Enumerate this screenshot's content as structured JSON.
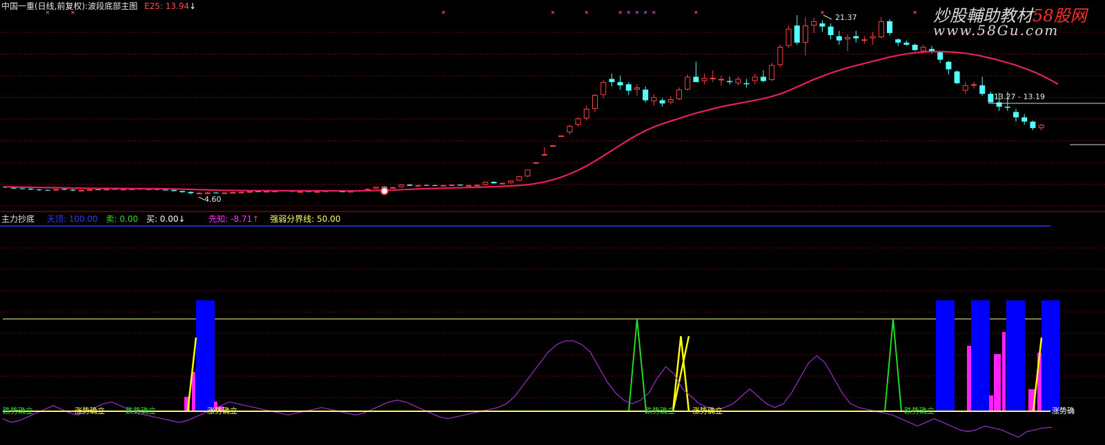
{
  "header": {
    "main_title": "中国一重(日线,前复权):波段底部主图",
    "ema_label": "E25: 13.94",
    "ema_arrow": "↓"
  },
  "watermark": {
    "line1": "炒股輔助教材",
    "brand": "58股网",
    "line2": "www.58Gu.com"
  },
  "indicator": {
    "name": "主力抄底",
    "tianding": "天顶: 100.00",
    "sell": "卖: 0.00",
    "buy": "买: 0.00",
    "buy_arrow": "↓",
    "xianzhi": "先知: -8.71",
    "xianzhi_arrow": "↑",
    "boundary": "强弱分界线: 50.00"
  },
  "annotations": {
    "high": "21.37",
    "low": "4.60",
    "range": "13.27 - 13.19"
  },
  "signals": {
    "items": [
      {
        "text": "跌势确立",
        "color": "#33dd33"
      },
      {
        "text": "涨势确立",
        "color": "#ffff44"
      },
      {
        "text": "跌势确立",
        "color": "#33dd33"
      },
      {
        "text": "涨势确立",
        "color": "#ffff44"
      },
      {
        "text": "跌势确立",
        "color": "#33dd33"
      },
      {
        "text": "涨势确立",
        "color": "#ffff44"
      },
      {
        "text": "跌势确立",
        "color": "#33dd33"
      },
      {
        "text": "涨势确",
        "color": "#ffffff"
      }
    ]
  },
  "colors": {
    "up": "#ff4444",
    "down": "#54ffff",
    "ema": "#e8205e",
    "divider": "#cc0000",
    "title": "#e6e6e6",
    "indicator_name": "#e6e6e6",
    "tianding": "#3333ff",
    "sell": "#33dd33",
    "buy": "#ffffff",
    "xianzhi": "#ff33ff",
    "boundary": "#ffff66",
    "magenta": "#ff22ff",
    "blue": "#0000ff",
    "yellow": "#ffff00",
    "green": "#22dd22",
    "purple": "#9933cc"
  },
  "chart_data": [
    {
      "type": "candlestick",
      "series": [
        {
          "name": "E25",
          "ohlc": [
            [
              5.3,
              5.36,
              5.18,
              5.25
            ],
            [
              5.24,
              5.3,
              5.1,
              5.14
            ],
            [
              5.15,
              5.22,
              5.08,
              5.12
            ],
            [
              5.12,
              5.18,
              4.98,
              5.04
            ],
            [
              5.04,
              5.1,
              4.92,
              4.98
            ],
            [
              5.0,
              5.06,
              4.94,
              4.99
            ],
            [
              5.0,
              5.12,
              4.95,
              5.08
            ],
            [
              5.1,
              5.22,
              5.0,
              5.02
            ],
            [
              5.03,
              5.08,
              4.9,
              4.95
            ],
            [
              4.96,
              5.04,
              4.88,
              5.0
            ],
            [
              5.0,
              5.1,
              4.96,
              5.06
            ],
            [
              5.06,
              5.14,
              5.0,
              5.02
            ],
            [
              5.05,
              5.25,
              5.0,
              5.1
            ],
            [
              5.1,
              5.14,
              5.02,
              5.08
            ],
            [
              5.08,
              5.16,
              5.04,
              5.1
            ],
            [
              5.1,
              5.22,
              5.05,
              5.12
            ],
            [
              5.12,
              5.18,
              5.0,
              5.05
            ],
            [
              5.06,
              5.16,
              5.04,
              5.12
            ],
            [
              5.12,
              5.16,
              4.98,
              5.02
            ],
            [
              5.02,
              5.08,
              4.96,
              5.0
            ],
            [
              5.0,
              5.04,
              4.86,
              4.9
            ],
            [
              4.9,
              4.96,
              4.72,
              4.8
            ],
            [
              4.82,
              4.86,
              4.6,
              4.7
            ],
            [
              4.7,
              4.78,
              4.6,
              4.74
            ],
            [
              4.74,
              4.82,
              4.7,
              4.76
            ],
            [
              4.76,
              4.8,
              4.66,
              4.7
            ],
            [
              4.72,
              4.78,
              4.68,
              4.76
            ],
            [
              4.76,
              4.84,
              4.72,
              4.8
            ],
            [
              4.8,
              4.86,
              4.76,
              4.82
            ],
            [
              4.82,
              4.9,
              4.78,
              4.88
            ],
            [
              4.88,
              4.94,
              4.84,
              4.86
            ],
            [
              4.86,
              4.92,
              4.8,
              4.9
            ],
            [
              4.9,
              4.96,
              4.86,
              4.92
            ],
            [
              4.92,
              4.98,
              4.88,
              4.9
            ],
            [
              4.9,
              4.94,
              4.84,
              4.86
            ],
            [
              4.86,
              4.92,
              4.82,
              4.88
            ],
            [
              4.88,
              4.94,
              4.84,
              4.84
            ],
            [
              4.86,
              4.92,
              4.8,
              4.88
            ],
            [
              4.88,
              4.96,
              4.86,
              4.94
            ],
            [
              4.94,
              4.98,
              4.84,
              4.86
            ],
            [
              4.86,
              4.92,
              4.82,
              4.84
            ],
            [
              4.86,
              4.92,
              4.8,
              4.9
            ],
            [
              4.9,
              5.0,
              4.86,
              4.98
            ],
            [
              4.98,
              5.14,
              4.94,
              5.1
            ],
            [
              5.1,
              5.34,
              5.06,
              5.3
            ],
            [
              5.3,
              5.38,
              5.16,
              5.2
            ],
            [
              5.2,
              5.3,
              5.14,
              5.26
            ],
            [
              5.26,
              5.56,
              5.22,
              5.5
            ],
            [
              5.5,
              5.56,
              5.36,
              5.4
            ],
            [
              5.4,
              5.5,
              5.34,
              5.46
            ],
            [
              5.46,
              5.52,
              5.4,
              5.44
            ],
            [
              5.44,
              5.5,
              5.38,
              5.4
            ],
            [
              5.4,
              5.48,
              5.34,
              5.46
            ],
            [
              5.46,
              5.54,
              5.42,
              5.5
            ],
            [
              5.5,
              5.52,
              5.4,
              5.42
            ],
            [
              5.42,
              5.48,
              5.38,
              5.46
            ],
            [
              5.46,
              5.52,
              5.4,
              5.48
            ],
            [
              5.48,
              5.8,
              5.44,
              5.76
            ],
            [
              5.76,
              5.82,
              5.6,
              5.62
            ],
            [
              5.62,
              5.7,
              5.54,
              5.66
            ],
            [
              5.66,
              5.9,
              5.6,
              5.88
            ],
            [
              5.88,
              6.32,
              5.84,
              6.28
            ],
            [
              6.28,
              6.9,
              6.2,
              6.9
            ],
            [
              7.59,
              7.59,
              7.59,
              7.59
            ],
            [
              8.3,
              9.0,
              8.3,
              8.35
            ],
            [
              9.18,
              9.18,
              9.18,
              9.18
            ],
            [
              10.1,
              10.1,
              10.1,
              10.1
            ],
            [
              10.4,
              11.1,
              10.2,
              11.0
            ],
            [
              11.1,
              11.8,
              10.9,
              11.7
            ],
            [
              11.7,
              12.9,
              11.5,
              12.6
            ],
            [
              12.6,
              14.0,
              12.3,
              13.9
            ],
            [
              13.9,
              15.3,
              13.6,
              15.1
            ],
            [
              15.4,
              15.9,
              14.7,
              15.1
            ],
            [
              15.1,
              15.7,
              14.4,
              14.8
            ],
            [
              14.9,
              15.1,
              13.9,
              14.3
            ],
            [
              14.4,
              14.9,
              13.8,
              14.6
            ],
            [
              14.4,
              14.7,
              13.2,
              13.4
            ],
            [
              13.3,
              14.0,
              12.9,
              13.7
            ],
            [
              13.4,
              13.6,
              12.8,
              13.1
            ],
            [
              13.2,
              13.8,
              13.0,
              13.5
            ],
            [
              13.5,
              14.6,
              13.4,
              14.4
            ],
            [
              14.4,
              15.8,
              14.3,
              15.6
            ],
            [
              15.6,
              17.0,
              15.4,
              15.1
            ],
            [
              15.2,
              15.9,
              14.9,
              15.5
            ],
            [
              15.4,
              16.2,
              15.1,
              15.5
            ],
            [
              15.3,
              15.7,
              14.8,
              15.4
            ],
            [
              15.2,
              15.6,
              14.9,
              15.1
            ],
            [
              15.0,
              15.6,
              14.8,
              15.4
            ],
            [
              15.0,
              15.4,
              14.6,
              14.9
            ],
            [
              15.2,
              15.9,
              14.9,
              15.6
            ],
            [
              15.6,
              16.2,
              15.1,
              15.2
            ],
            [
              15.3,
              16.9,
              15.2,
              16.7
            ],
            [
              16.7,
              18.6,
              16.5,
              18.4
            ],
            [
              18.5,
              20.4,
              18.3,
              20.1
            ],
            [
              20.4,
              21.37,
              18.6,
              18.8
            ],
            [
              18.8,
              21.2,
              17.6,
              20.4
            ],
            [
              20.4,
              21.1,
              19.7,
              20.8
            ],
            [
              20.6,
              20.9,
              19.8,
              20.3
            ],
            [
              20.3,
              20.6,
              19.1,
              19.5
            ],
            [
              19.4,
              19.9,
              18.6,
              19.0
            ],
            [
              19.1,
              19.6,
              18.0,
              19.3
            ],
            [
              19.4,
              19.9,
              18.8,
              19.2
            ],
            [
              19.0,
              19.4,
              18.7,
              19.1
            ],
            [
              19.2,
              19.8,
              18.6,
              19.4
            ],
            [
              19.3,
              21.2,
              19.2,
              20.8
            ],
            [
              20.8,
              21.0,
              19.5,
              19.7
            ],
            [
              19.1,
              19.2,
              18.5,
              18.8
            ],
            [
              18.8,
              19.0,
              18.5,
              18.6
            ],
            [
              18.6,
              18.7,
              18.0,
              18.1
            ],
            [
              18.0,
              18.6,
              17.8,
              18.4
            ],
            [
              18.2,
              18.5,
              17.8,
              17.9
            ],
            [
              17.9,
              17.9,
              16.9,
              17.2
            ],
            [
              17.0,
              17.1,
              15.8,
              16.3
            ],
            [
              16.1,
              16.2,
              14.9,
              15.0
            ],
            [
              14.3,
              15.1,
              14.0,
              14.8
            ],
            [
              14.8,
              15.1,
              14.5,
              14.9
            ],
            [
              14.8,
              15.6,
              13.8,
              14.0
            ],
            [
              14.0,
              14.2,
              13.2,
              13.2
            ],
            [
              13.2,
              14.1,
              12.4,
              12.8
            ],
            [
              12.8,
              14.2,
              12.4,
              12.7
            ],
            [
              12.3,
              12.6,
              11.4,
              11.8
            ],
            [
              11.8,
              12.1,
              11.1,
              11.4
            ],
            [
              11.4,
              11.5,
              10.6,
              10.8
            ],
            [
              10.8,
              11.2,
              10.6,
              11.1
            ]
          ],
          "ema": [
            5.3,
            5.28,
            5.27,
            5.25,
            5.23,
            5.22,
            5.21,
            5.2,
            5.18,
            5.17,
            5.16,
            5.15,
            5.15,
            5.14,
            5.14,
            5.13,
            5.13,
            5.12,
            5.12,
            5.11,
            5.1,
            5.08,
            5.05,
            5.03,
            5.01,
            4.99,
            4.97,
            4.96,
            4.95,
            4.94,
            4.94,
            4.94,
            4.93,
            4.93,
            4.93,
            4.93,
            4.92,
            4.92,
            4.92,
            4.92,
            4.91,
            4.91,
            4.92,
            4.93,
            4.95,
            4.97,
            4.99,
            5.03,
            5.06,
            5.09,
            5.12,
            5.14,
            5.17,
            5.19,
            5.21,
            5.23,
            5.25,
            5.28,
            5.31,
            5.34,
            5.38,
            5.43,
            5.49,
            5.61,
            5.75,
            5.95,
            6.2,
            6.5,
            6.85,
            7.25,
            7.7,
            8.2,
            8.7,
            9.2,
            9.7,
            10.15,
            10.55,
            10.9,
            11.2,
            11.45,
            11.7,
            11.95,
            12.2,
            12.4,
            12.6,
            12.8,
            12.95,
            13.1,
            13.25,
            13.4,
            13.55,
            13.75,
            14.0,
            14.3,
            14.65,
            15.0,
            15.35,
            15.65,
            15.95,
            16.2,
            16.45,
            16.65,
            16.85,
            17.05,
            17.25,
            17.45,
            17.6,
            17.75,
            17.85,
            17.92,
            17.96,
            17.96,
            17.93,
            17.88,
            17.8,
            17.68,
            17.52,
            17.34,
            17.14,
            16.92,
            16.68,
            16.4,
            16.1,
            15.75,
            15.35,
            14.9
          ]
        }
      ],
      "annotations": [
        "21.37",
        "4.60",
        "13.27 - 13.19"
      ],
      "ylim": [
        3.0,
        22.5
      ],
      "grid": true
    },
    {
      "type": "line",
      "series": [
        {
          "name": "先知",
          "values": [
            -4,
            -6,
            -5,
            -3,
            -1,
            1,
            3,
            1,
            -1,
            -2,
            0,
            2,
            4,
            5,
            3,
            1,
            -1,
            -2,
            -3,
            -4,
            -5,
            -6,
            -5,
            -3,
            -1,
            1,
            3,
            5,
            4,
            3,
            2,
            1,
            0,
            -1,
            -2,
            -1,
            0,
            1,
            2,
            1,
            0,
            -1,
            -2,
            -1,
            1,
            3,
            5,
            6,
            5,
            3,
            1,
            -1,
            -3,
            -4,
            -3,
            -2,
            -1,
            0,
            1,
            2,
            4,
            8,
            14,
            20,
            26,
            32,
            36,
            38,
            38,
            36,
            32,
            24,
            16,
            10,
            6,
            4,
            6,
            10,
            18,
            24,
            20,
            12,
            8,
            4,
            2,
            1,
            2,
            4,
            8,
            12,
            8,
            4,
            2,
            4,
            10,
            18,
            26,
            30,
            26,
            18,
            10,
            4,
            2,
            1,
            0,
            -1,
            -2,
            -4,
            -6,
            -8,
            -6,
            -4,
            -6,
            -8,
            -10,
            -11,
            -10,
            -8,
            -9,
            -10,
            -12,
            -14,
            -11,
            -10,
            -9,
            -8.71
          ]
        }
      ],
      "ylim": [
        -15,
        100
      ],
      "grid": true
    }
  ]
}
